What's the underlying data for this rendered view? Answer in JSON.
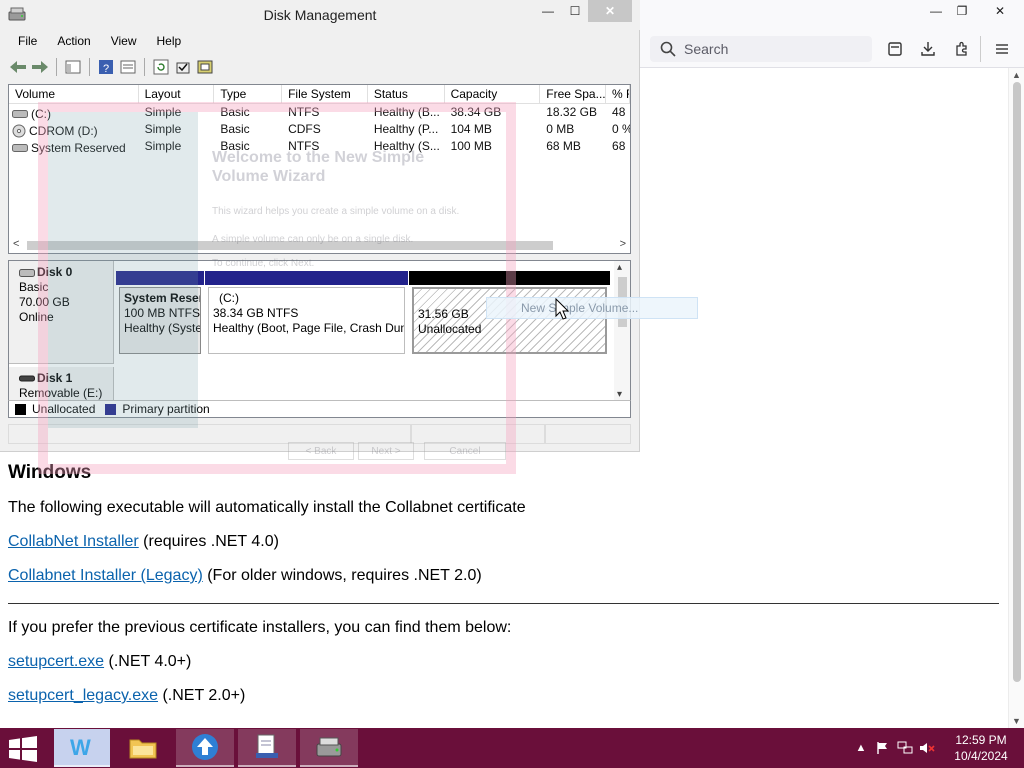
{
  "browser": {
    "search_placeholder": "Search"
  },
  "page": {
    "heading": "Windows",
    "intro": "The following executable will automatically install the Collabnet certificate",
    "link1": "CollabNet Installer",
    "link1_note": " (requires .NET 4.0)",
    "link2": "Collabnet Installer (Legacy)",
    "link2_note": " (For older windows, requires .NET 2.0)",
    "prev_text": "If you prefer the previous certificate installers, you can find them below:",
    "link3": "setupcert.exe",
    "link3_note": " (.NET 4.0+)",
    "link4": "setupcert_legacy.exe",
    "link4_note": " (.NET 2.0+)"
  },
  "dm": {
    "title": "Disk Management",
    "menu": [
      "File",
      "Action",
      "View",
      "Help"
    ],
    "columns": [
      "Volume",
      "Layout",
      "Type",
      "File System",
      "Status",
      "Capacity",
      "Free Spa...",
      "% F"
    ],
    "rows": [
      [
        "(C:)",
        "Simple",
        "Basic",
        "NTFS",
        "Healthy (B...",
        "38.34 GB",
        "18.32 GB",
        "48"
      ],
      [
        "CDROM (D:)",
        "Simple",
        "Basic",
        "CDFS",
        "Healthy (P...",
        "104 MB",
        "0 MB",
        "0 %"
      ],
      [
        "System Reserved",
        "Simple",
        "Basic",
        "NTFS",
        "Healthy (S...",
        "100 MB",
        "68 MB",
        "68"
      ]
    ],
    "disk0": {
      "name": "Disk 0",
      "type": "Basic",
      "size": "70.00 GB",
      "state": "Online",
      "partitions": [
        {
          "title": "System Reser",
          "line1": "100 MB NTFS",
          "line2": "Healthy (Syste"
        },
        {
          "title": "(C:)",
          "line1": "38.34 GB NTFS",
          "line2": "Healthy (Boot, Page File, Crash Dum"
        },
        {
          "title": "",
          "line1": "31.56 GB",
          "line2": "Unallocated"
        }
      ]
    },
    "disk1": {
      "name": "Disk 1",
      "type": "Removable (E:)"
    },
    "legend": {
      "unallocated": "Unallocated",
      "primary": "Primary partition"
    },
    "context_menu_item": "New Simple Volume...",
    "colors": {
      "primary": "#22228b",
      "unallocated": "#000000",
      "accent": "#0b63ad",
      "taskbar": "#6a0f3a"
    }
  },
  "wizard": {
    "title": "Welcome to the New Simple Volume Wizard",
    "line1": "This wizard helps you create a simple volume on a disk.",
    "line2": "A simple volume can only be on a single disk.",
    "line3": "To continue, click Next.",
    "back": "< Back",
    "next": "Next >",
    "cancel": "Cancel"
  },
  "taskbar": {
    "time": "12:59 PM",
    "date": "10/4/2024"
  }
}
